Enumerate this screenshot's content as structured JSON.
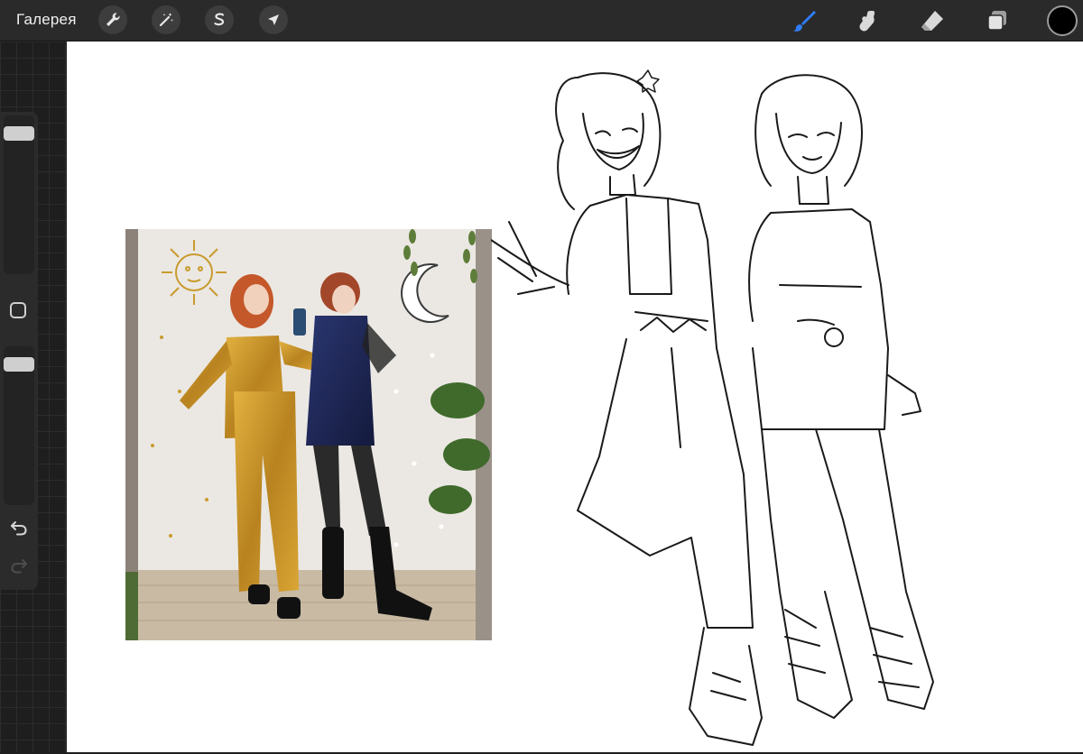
{
  "toolbar": {
    "gallery_label": "Галерея",
    "left_tools": [
      {
        "icon": "wrench-icon",
        "name": "actions-button"
      },
      {
        "icon": "magic-wand-icon",
        "name": "adjustments-button"
      },
      {
        "icon": "selection-s-icon",
        "name": "selection-button"
      },
      {
        "icon": "arrow-cursor-icon",
        "name": "transform-button"
      }
    ],
    "right_tools": [
      {
        "icon": "brush-icon",
        "name": "brush-tool",
        "active": true
      },
      {
        "icon": "smudge-icon",
        "name": "smudge-tool",
        "active": false
      },
      {
        "icon": "eraser-icon",
        "name": "eraser-tool",
        "active": false
      },
      {
        "icon": "layers-icon",
        "name": "layers-button",
        "active": false
      }
    ],
    "current_color": "#000000",
    "accent_color": "#2f7df6"
  },
  "sidebar": {
    "brush_size": 0.95,
    "opacity": 0.95,
    "undo_icon": "undo-icon",
    "redo_icon": "redo-icon"
  },
  "canvas": {
    "background": "#ffffff",
    "photo_palette": {
      "mustard": "#c9962a",
      "navy": "#1c2451",
      "wall": "#ece8e2",
      "floor": "#c7b8a3"
    }
  }
}
